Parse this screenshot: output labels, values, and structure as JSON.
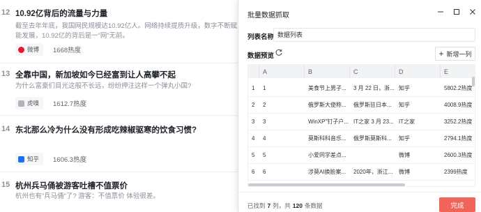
{
  "list": {
    "items": [
      {
        "rank": "12",
        "title": "10.92亿背后的流量与力量",
        "desc": "截至去年年底，我国网民规模达10.92亿人。网络持续提质升级，数字不断赋能发展，10.92亿的背后是一“网”无前。",
        "source": "微博",
        "source_color": "#e6162d",
        "hot": "1668热度"
      },
      {
        "rank": "13",
        "title": "全靠中国，新加坡如今已经富到让人高攀不起",
        "desc": "为什么富豪们目光这般不长远，纷纷押注这样一个弹丸小国?",
        "source": "虎嗅",
        "source_color": "#b0b4ba",
        "hot": "1612.7热度"
      },
      {
        "rank": "14",
        "title": "东北那么冷为什么没有形成吃辣椒驱寒的饮食习惯?",
        "desc": "",
        "source": "知乎",
        "source_color": "#1772f6",
        "hot": "1606.3热度"
      },
      {
        "rank": "15",
        "title": "杭州兵马俑被游客吐槽不值票价",
        "desc": "杭州也有“兵马俑”了? 游客：不值票价 体验很差。",
        "source": "",
        "source_color": "",
        "hot": ""
      }
    ]
  },
  "dialog": {
    "title": "批量数据抓取",
    "minimize_icon": "minimize-icon",
    "maximize_icon": "maximize-icon",
    "close_icon": "close-icon",
    "field_label": "列表名称:",
    "field_value": "数据列表",
    "preview_label": "数据预览",
    "add_column_label": "新增一列",
    "columns": [
      "",
      "A",
      "B",
      "C",
      "D",
      "E"
    ],
    "rows": [
      [
        "1",
        "1",
        "美食节上男子...",
        "3 月 22 日，浙...",
        "知乎",
        "5802.2热度"
      ],
      [
        "2",
        "2",
        "俄罗斯大使称...",
        "俄罗斯驻日本...",
        "知乎",
        "4008.9热度"
      ],
      [
        "3",
        "3",
        "WinXP\"钉子户...",
        "IT之家 3 月 23...",
        "IT之家",
        "3252.2热度"
      ],
      [
        "4",
        "4",
        "莫斯科科音乐...",
        "俄罗斯莫斯科...",
        "知乎",
        "2794.1热度"
      ],
      [
        "5",
        "5",
        "小爱同学差点...",
        "",
        "微博",
        "2600.3热度"
      ],
      [
        "6",
        "6",
        "涉莫AI换脸案...",
        "2020年，浙江...",
        "微博",
        "2399热度"
      ]
    ],
    "status_prefix": "已找到",
    "status_cols": "7",
    "status_mid": "列，共",
    "status_rows": "120",
    "status_suffix": "条数据",
    "done_label": "完成",
    "accent": "#f0645a"
  }
}
